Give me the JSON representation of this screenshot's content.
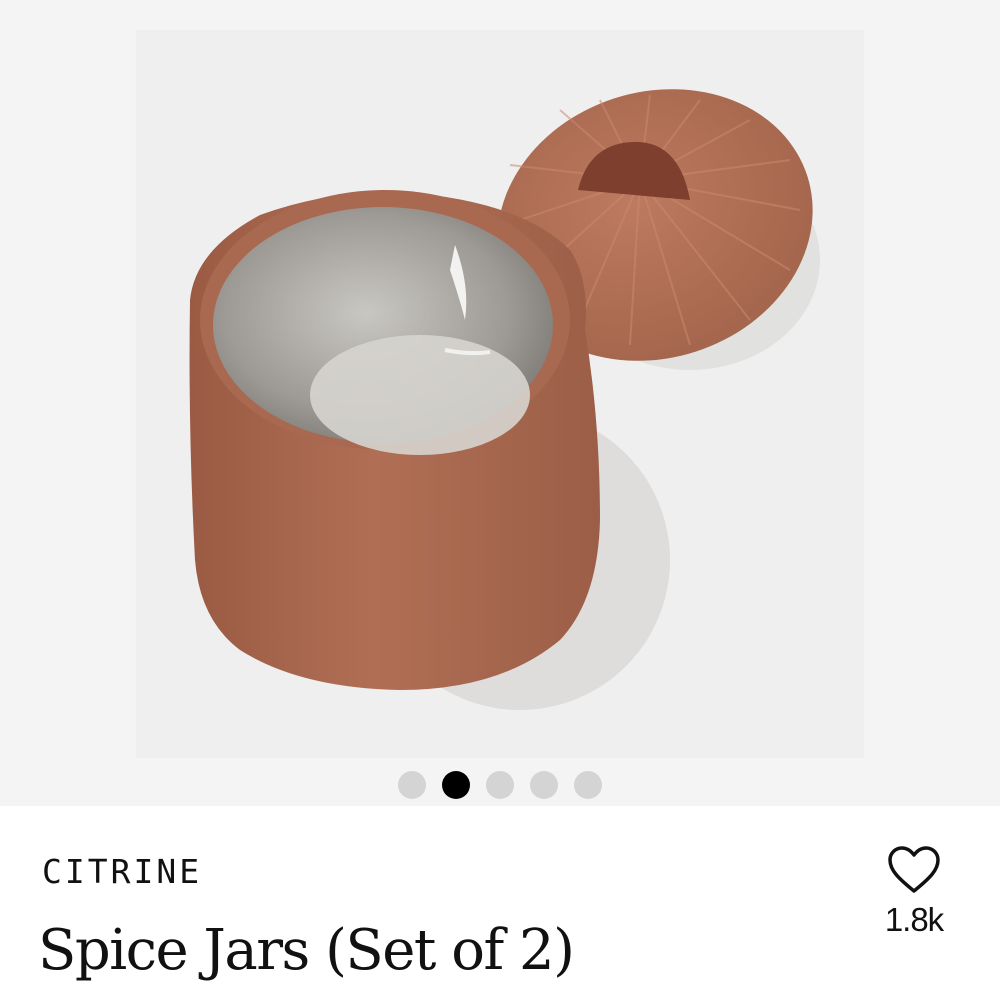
{
  "product": {
    "brand": "CITRINE",
    "title": "Spice Jars (Set of 2)",
    "favorites_count": "1.8k",
    "image_alt": "Terracotta spice jar with lid"
  },
  "gallery": {
    "slide_count": 5,
    "active_index": 1
  },
  "icons": {
    "favorite": "heart-outline-icon"
  },
  "colors": {
    "background": "#ffffff",
    "gallery_bg": "#f4f4f4",
    "dot_inactive": "#d4d4d4",
    "dot_active": "#000000",
    "text": "#111111"
  }
}
